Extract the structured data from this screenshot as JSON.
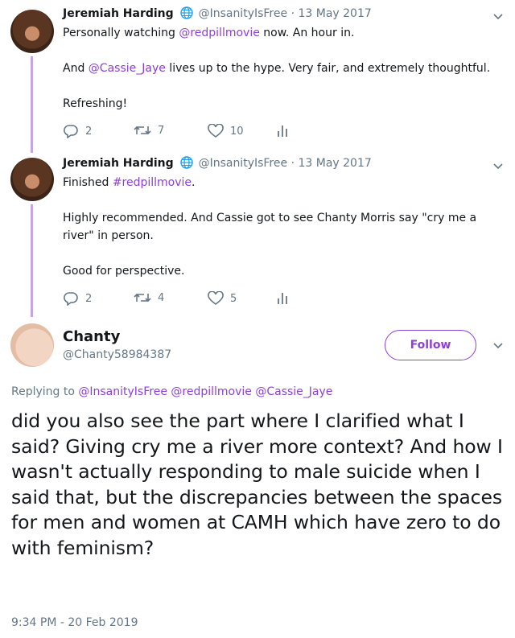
{
  "thread": [
    {
      "author": "Jeremiah Harding",
      "handle": "@InsanityIsFree",
      "date": "13 May 2017",
      "line1_plain": "Personally watching ",
      "line1_link": "@redpillmovie",
      "line1_tail": " now. An hour in.",
      "line2_pre": "And ",
      "line2_link": "@Cassie_Jaye",
      "line2_tail": " lives up to the hype. Very fair, and extremely thoughtful.",
      "line3": "Refreshing!",
      "replies": "2",
      "retweets": "7",
      "likes": "10"
    },
    {
      "author": "Jeremiah Harding",
      "handle": "@InsanityIsFree",
      "date": "13 May 2017",
      "line1_plain": "Finished ",
      "line1_link": "#redpillmovie",
      "line1_tail": ".",
      "line2": "Highly recommended. And Cassie got to see Chanty Morris say \"cry me a river\" in person.",
      "line3": "Good for perspective.",
      "replies": "2",
      "retweets": "4",
      "likes": "5"
    }
  ],
  "main": {
    "author": "Chanty",
    "handle": "@Chanty58984387",
    "follow_label": "Follow",
    "replying_label": "Replying to",
    "replying_to": [
      "@InsanityIsFree",
      "@redpillmovie",
      "@Cassie_Jaye"
    ],
    "text": "did you also see the part where I clarified what I said? Giving cry me a river more context? And how I wasn't actually responding to male suicide when I said that, but the discrepancies between the spaces for men and women at CAMH which have zero to do with feminism?",
    "timestamp": "9:34 PM - 20 Feb 2019"
  },
  "colors": {
    "accent": "#8e3fd8",
    "thread_line": "#c4a8e6",
    "muted": "#657786",
    "globe": "#1da1f2"
  }
}
